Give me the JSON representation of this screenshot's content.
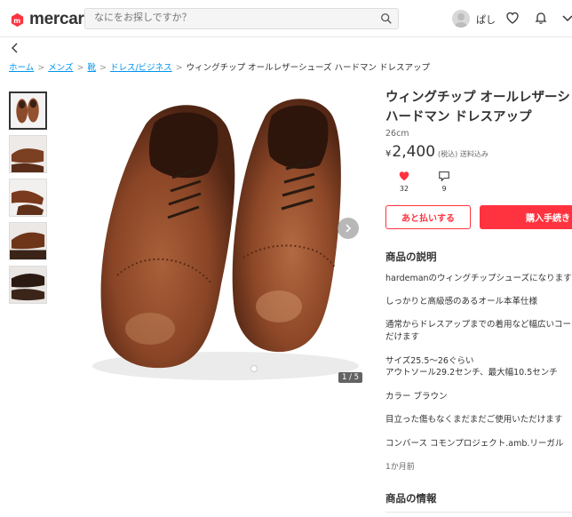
{
  "header": {
    "logo_text": "mercari",
    "search_placeholder": "なにをお探しですか？",
    "user_name": "ぱし",
    "icons": [
      "search-icon",
      "avatar",
      "heart-icon",
      "bell-icon",
      "chevron-down-icon"
    ]
  },
  "breadcrumb": {
    "items": [
      "ホーム",
      "メンズ",
      "靴",
      "ドレス/ビジネス"
    ],
    "current": "ウィングチップ オールレザーシューズ ハードマン ドレスアップ"
  },
  "gallery": {
    "counter": "1 / 5"
  },
  "product": {
    "title_line1": "ウィングチップ オールレザーシ",
    "title_line2": "ハードマン ドレスアップ",
    "size": "26cm",
    "price_yen": "¥",
    "price": "2,400",
    "tax_note": "(税込) 送料込み",
    "likes": "32",
    "comments": "9",
    "btn_pay_later": "あと払いする",
    "btn_buy": "購入手続き"
  },
  "description": {
    "heading": "商品の説明",
    "lines": [
      "hardemanのウィングチップシューズになります",
      "しっかりと高級感のあるオール本革仕様",
      "通常からドレスアップまでの着用など幅広いコー",
      "だけます",
      "サイズ25.5〜26ぐらい",
      "アウトソール29.2センチ、最大幅10.5センチ",
      "カラー ブラウン",
      "目立った傷もなくまだまだご使用いただけます",
      "コンバース コモンプロジェクト.amb.リーガル"
    ],
    "posted": "1か月前"
  },
  "info": {
    "heading": "商品の情報"
  },
  "colors": {
    "brand_red": "#ff333f",
    "link_blue": "#0095ee"
  }
}
